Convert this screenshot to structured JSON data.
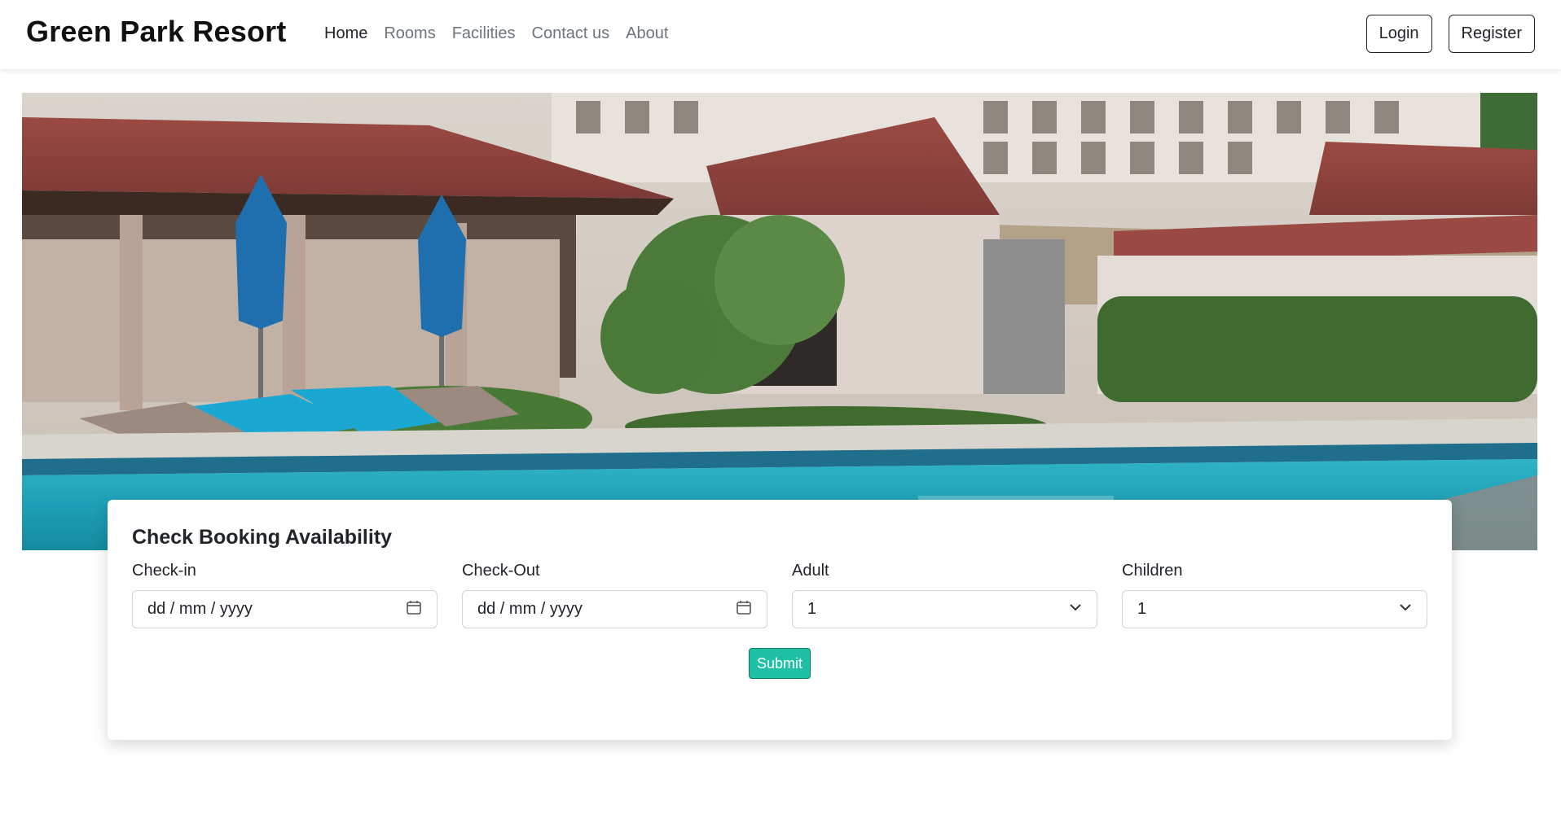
{
  "navbar": {
    "brand": "Green Park Resort",
    "links": [
      {
        "label": "Home",
        "active": true
      },
      {
        "label": "Rooms",
        "active": false
      },
      {
        "label": "Facilities",
        "active": false
      },
      {
        "label": "Contact us",
        "active": false
      },
      {
        "label": "About",
        "active": false
      }
    ],
    "login_label": "Login",
    "register_label": "Register"
  },
  "booking": {
    "title": "Check Booking Availability",
    "checkin": {
      "label": "Check-in",
      "placeholder": "dd / mm / yyyy",
      "icon": "calendar-icon"
    },
    "checkout": {
      "label": "Check-Out",
      "placeholder": "dd / mm / yyyy",
      "icon": "calendar-icon"
    },
    "adult": {
      "label": "Adult",
      "value": "1",
      "icon": "chevron-down-icon"
    },
    "children": {
      "label": "Children",
      "value": "1",
      "icon": "chevron-down-icon"
    },
    "submit_label": "Submit"
  },
  "colors": {
    "submit": "#20c0a4",
    "nav_active": "#212529",
    "nav_inactive": "#6c757d"
  }
}
